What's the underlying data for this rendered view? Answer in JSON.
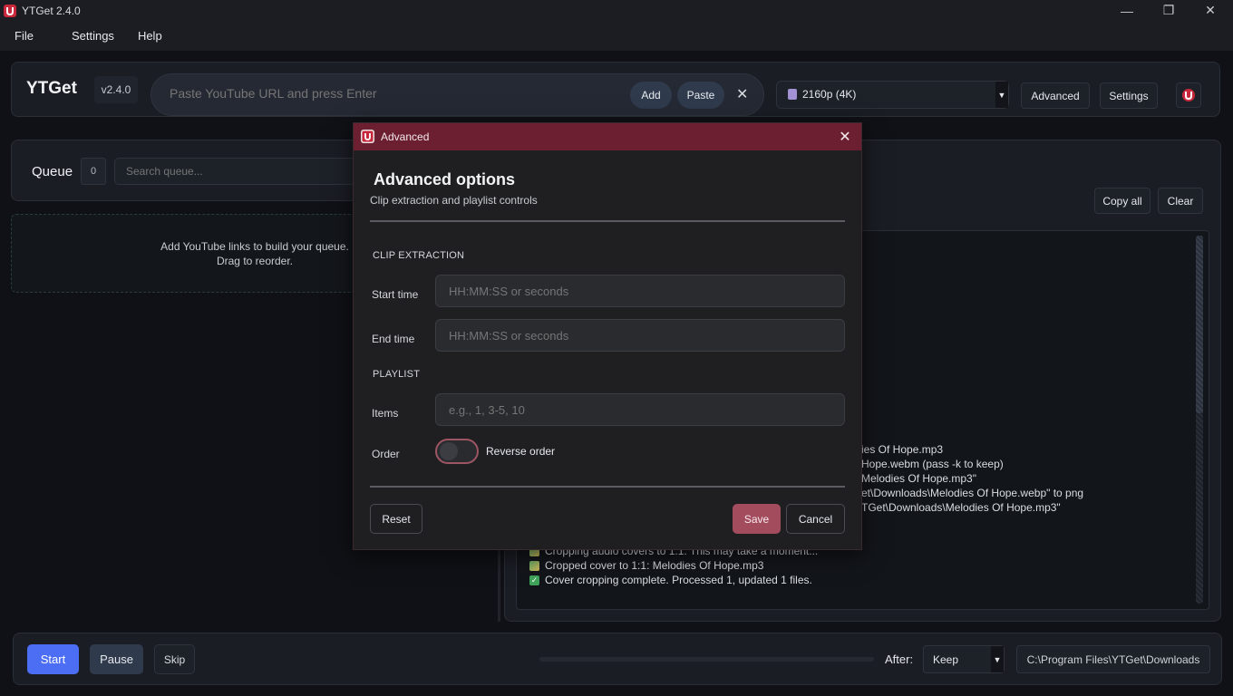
{
  "window": {
    "title": "YTGet 2.4.0",
    "controls": {
      "minimize": "—",
      "maximize": "❐",
      "close": "✕"
    }
  },
  "menu": {
    "items": [
      "File",
      "Settings",
      "Help"
    ]
  },
  "header": {
    "brand": "YTGet",
    "version": "v2.4.0",
    "url_placeholder": "Paste YouTube URL and press Enter",
    "add_label": "Add",
    "paste_label": "Paste",
    "clear_icon": "✕",
    "quality_value": "2160p (4K)",
    "advanced_label": "Advanced",
    "settings_label": "Settings"
  },
  "queue": {
    "title": "Queue",
    "count": "0",
    "search_placeholder": "Search queue...",
    "empty_line1": "Add YouTube links to build your queue.",
    "empty_line2": "Drag to reorder."
  },
  "log": {
    "copy_all_label": "Copy all",
    "clear_label": "Clear",
    "lines": [
      {
        "icon": "none",
        "text": "ies Of Hope.mp3"
      },
      {
        "icon": "none",
        "text": "Hope.webm (pass -k to keep)"
      },
      {
        "icon": "none",
        "text": "Melodies Of Hope.mp3\""
      },
      {
        "icon": "none",
        "text": "et\\Downloads\\Melodies Of Hope.webp\" to png"
      },
      {
        "icon": "none",
        "text": "TGet\\Downloads\\Melodies Of Hope.mp3\""
      },
      {
        "icon": "image",
        "text": "Cropping audio covers to 1:1. This may take a moment..."
      },
      {
        "icon": "image",
        "text": "Cropped cover to 1:1: Melodies Of Hope.mp3"
      },
      {
        "icon": "check",
        "text": "Cover cropping complete. Processed 1, updated 1 files."
      }
    ]
  },
  "bottom": {
    "start_label": "Start",
    "pause_label": "Pause",
    "skip_label": "Skip",
    "progress": 0,
    "after_label": "After:",
    "after_value": "Keep",
    "download_path": "C:\\Program Files\\YTGet\\Downloads"
  },
  "dialog": {
    "title": "Advanced",
    "close_icon": "✕",
    "heading": "Advanced options",
    "subtitle": "Clip extraction and playlist controls",
    "section_clip": "CLIP EXTRACTION",
    "start_label": "Start time",
    "start_placeholder": "HH:MM:SS or seconds",
    "end_label": "End time",
    "end_placeholder": "HH:MM:SS or seconds",
    "section_playlist": "PLAYLIST",
    "items_label": "Items",
    "items_placeholder": "e.g., 1, 3-5, 10",
    "order_label": "Order",
    "reverse_label": "Reverse order",
    "reverse_on": false,
    "reset_label": "Reset",
    "save_label": "Save",
    "cancel_label": "Cancel"
  },
  "colors": {
    "accent": "#4b6ef5",
    "dialog_title_bg": "#6b1f30",
    "save_button": "#a24c5e",
    "brand_icon": "#c8283c"
  }
}
